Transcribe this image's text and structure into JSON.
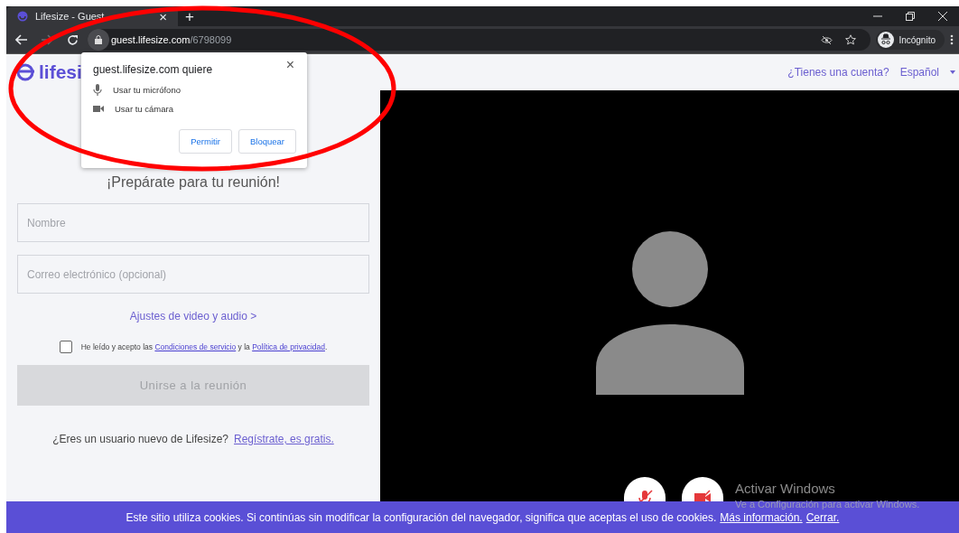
{
  "browser": {
    "tab": {
      "title": "Lifesize - Guest",
      "close": "×"
    },
    "new_tab": "+",
    "nav": {
      "back_disabled": false,
      "forward_disabled": true
    },
    "url": {
      "host": "guest.lifesize.com",
      "path": "/6798099"
    },
    "profile": "Incógnito"
  },
  "header": {
    "logo": "lifesi",
    "account_link": "¿Tienes una cuenta?",
    "language": "Español"
  },
  "permission_popup": {
    "title": "guest.lifesize.com quiere",
    "close": "×",
    "requests": [
      {
        "kind": "microphone",
        "label": "Usar tu micrófono"
      },
      {
        "kind": "camera",
        "label": "Usar tu cámara"
      }
    ],
    "buttons": [
      "Permitir",
      "Bloquear"
    ]
  },
  "form": {
    "title": "¡Prepárate para tu reunión!",
    "fields": [
      {
        "placeholder": "Nombre"
      },
      {
        "placeholder": "Correo electrónico (opcional)"
      }
    ],
    "settings_link": "Ajustes de video y audio >",
    "terms": {
      "checked": false,
      "text": "He leído y acepto las ",
      "link1": "Condiciones de servicio",
      "middle": " y la ",
      "link2": "Política de privacidad",
      "end": "."
    },
    "join_button": {
      "label": "Unirse a la reunión",
      "disabled": true
    },
    "signup": {
      "text": "¿Eres un usuario nuevo de Lifesize?",
      "link": "Regístrate, es gratis."
    }
  },
  "video_controls": [
    {
      "kind": "microphone",
      "muted": true
    },
    {
      "kind": "camera",
      "muted": true
    }
  ],
  "os_watermark": {
    "title": "Activar Windows",
    "subtitle": "Ve a Configuración para activar Windows."
  },
  "cookie_bar": {
    "text": "Este sitio utiliza cookies. Si continúas sin modificar la configuración del navegador, significa que aceptas el uso de cookies.",
    "more_link": "Más información.",
    "close_link": "Cerrar."
  }
}
